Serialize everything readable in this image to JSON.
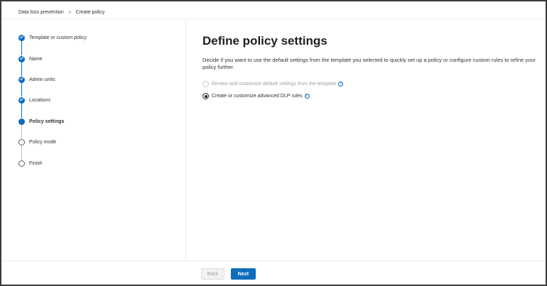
{
  "breadcrumb": {
    "items": [
      "Data loss prevention",
      "Create policy"
    ],
    "separator": ">"
  },
  "wizard": {
    "steps": [
      {
        "label": "Template or custom policy",
        "state": "done"
      },
      {
        "label": "Name",
        "state": "done"
      },
      {
        "label": "Admin units",
        "state": "done"
      },
      {
        "label": "Locations",
        "state": "done"
      },
      {
        "label": "Policy settings",
        "state": "current"
      },
      {
        "label": "Policy mode",
        "state": "todo"
      },
      {
        "label": "Finish",
        "state": "todo"
      }
    ]
  },
  "main": {
    "title": "Define policy settings",
    "description": "Decide if you want to use the default settings from the template you selected to quickly set up a policy or configure custom rules to refine your policy further.",
    "options": [
      {
        "label": "Review and customize default settings from the template",
        "selected": false,
        "disabled": true
      },
      {
        "label": "Create or customize advanced DLP rules",
        "selected": true,
        "disabled": false
      }
    ],
    "info_glyph": "i"
  },
  "footer": {
    "back_label": "Back",
    "next_label": "Next"
  },
  "colors": {
    "accent": "#0f6cbd",
    "text": "#323130",
    "disabled": "#a19f9d"
  },
  "icons": {
    "step_done": "check-circle-icon",
    "step_current": "filled-circle-icon",
    "step_todo": "empty-circle-icon",
    "info": "info-icon"
  }
}
